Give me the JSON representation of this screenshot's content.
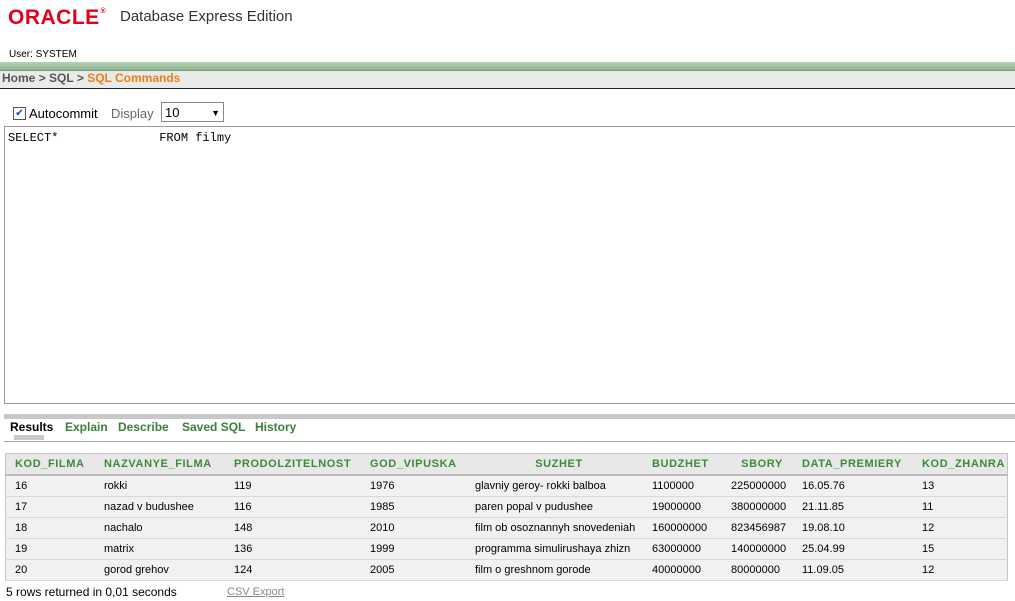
{
  "header": {
    "logo_text": "ORACLE",
    "logo_mark": "®",
    "product": "Database Express Edition",
    "user_label": "User: SYSTEM"
  },
  "breadcrumb": {
    "home": "Home",
    "sep1": ">",
    "sql": "SQL",
    "sep2": ">",
    "current": "SQL Commands"
  },
  "toolbar": {
    "autocommit_label": "Autocommit",
    "autocommit_checked": true,
    "display_label": "Display",
    "display_value": "10"
  },
  "editor": {
    "query": "SELECT*              FROM filmy"
  },
  "tabs": [
    {
      "label": "Results",
      "active": true
    },
    {
      "label": "Explain",
      "active": false
    },
    {
      "label": "Describe",
      "active": false
    },
    {
      "label": "Saved SQL",
      "active": false
    },
    {
      "label": "History",
      "active": false
    }
  ],
  "results": {
    "columns": [
      "KOD_FILMA",
      "NAZVANYE_FILMA",
      "PRODOLZITELNOST",
      "GOD_VIPUSKA",
      "SUZHET",
      "BUDZHET",
      "SBORY",
      "DATA_PREMIERY",
      "KOD_ZHANRA"
    ],
    "rows": [
      [
        "16",
        "rokki",
        "119",
        "1976",
        "glavniy geroy- rokki balboa",
        "1100000",
        "225000000",
        "16.05.76",
        "13"
      ],
      [
        "17",
        "nazad v budushee",
        "116",
        "1985",
        "paren popal v pudushee",
        "19000000",
        "380000000",
        "21.11.85",
        "11"
      ],
      [
        "18",
        "nachalo",
        "148",
        "2010",
        "film ob osoznannyh snovedeniah",
        "160000000",
        "823456987",
        "19.08.10",
        "12"
      ],
      [
        "19",
        "matrix",
        "136",
        "1999",
        "programma simulirushaya zhizn",
        "63000000",
        "140000000",
        "25.04.99",
        "15"
      ],
      [
        "20",
        "gorod grehov",
        "124",
        "2005",
        "film o greshnom gorode",
        "40000000",
        "80000000",
        "11.09.05",
        "12"
      ]
    ]
  },
  "footer": {
    "status": "5 rows returned in 0,01 seconds",
    "csv_export": "CSV Export"
  },
  "colors": {
    "brand_red": "#e4001b",
    "accent_orange": "#f07c19",
    "tab_green": "#3a7f3a"
  }
}
